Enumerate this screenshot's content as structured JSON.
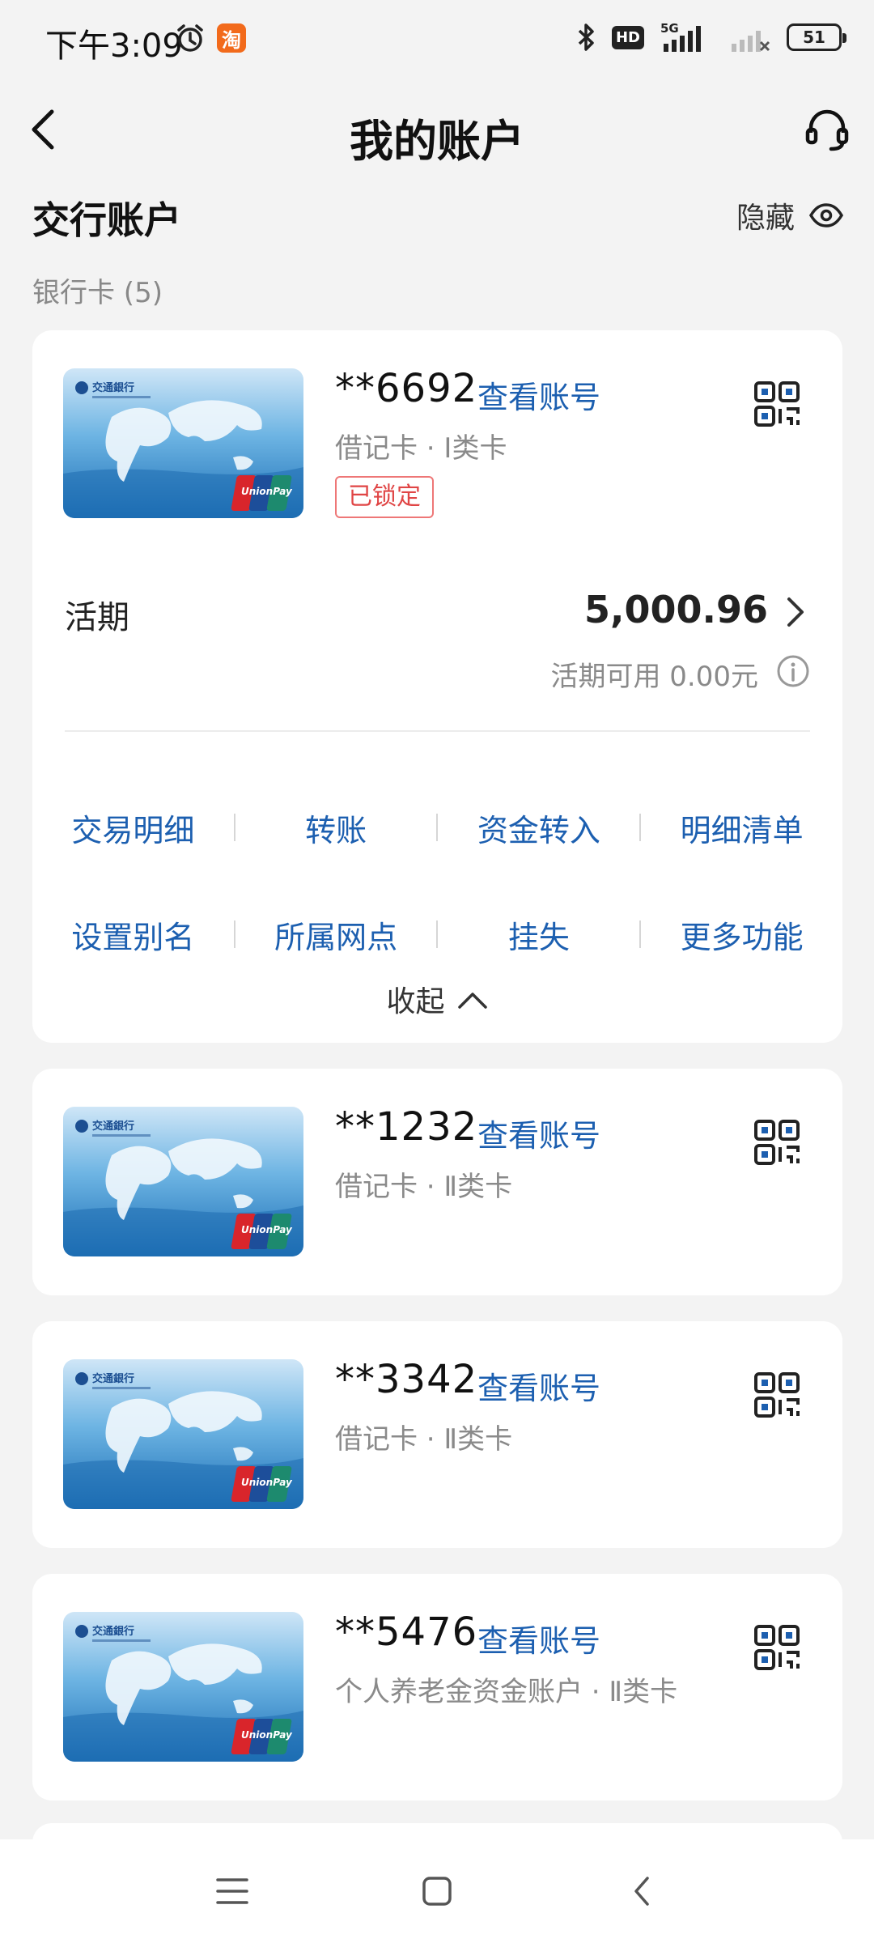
{
  "status_bar": {
    "time": "下午3:09",
    "taobao_badge": "淘",
    "hd": "HD",
    "network": "5G",
    "battery": "51"
  },
  "header": {
    "title": "我的账户"
  },
  "section": {
    "title": "交行账户",
    "hide_label": "隐藏",
    "bank_card_count": "银行卡 (5)"
  },
  "cards": [
    {
      "number": "**6692",
      "view_label": "查看账号",
      "type": "借记卡 · Ⅰ类卡",
      "status": "已锁定",
      "expanded": {
        "account_label": "活期",
        "balance": "5,000.96",
        "available": "活期可用 0.00元",
        "actions_row1": [
          "交易明细",
          "转账",
          "资金转入",
          "明细清单"
        ],
        "actions_row2": [
          "设置别名",
          "所属网点",
          "挂失",
          "更多功能"
        ],
        "collapse_label": "收起"
      }
    },
    {
      "number": "**1232",
      "view_label": "查看账号",
      "type": "借记卡 · Ⅱ类卡"
    },
    {
      "number": "**3342",
      "view_label": "查看账号",
      "type": "借记卡 · Ⅱ类卡"
    },
    {
      "number": "**5476",
      "view_label": "查看账号",
      "type": "个人养老金资金账户 · Ⅱ类卡"
    }
  ],
  "icons": {
    "back": "chevron-left-icon",
    "service": "headset-icon",
    "eye": "eye-icon",
    "qr": "qr-code-icon",
    "info": "info-icon"
  },
  "colors": {
    "link_blue": "#1c5fb0",
    "locked_red": "#e04545",
    "background": "#f3f3f3"
  }
}
